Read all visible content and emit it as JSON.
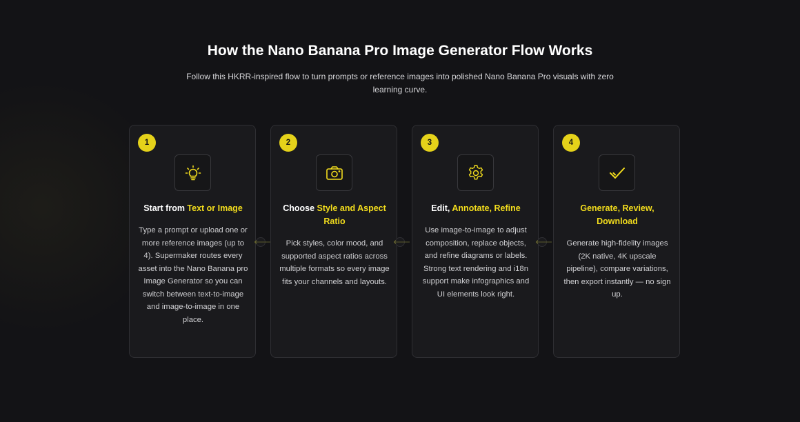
{
  "header": {
    "title": "How the Nano Banana Pro Image Generator Flow Works",
    "subtitle_line1": "Follow this HKRR-inspired flow to turn prompts or reference images into polished Nano Banana Pro visuals with zero",
    "subtitle_line2": "learning curve."
  },
  "colors": {
    "accent": "#f3dd1d",
    "badge": "#e5d21a",
    "background": "#131316",
    "card": "#1a1a1d"
  },
  "steps": [
    {
      "number": "1",
      "icon": "lightbulb-icon",
      "heading_plain": "Start from ",
      "heading_highlight": "Text or Image",
      "body": "Type a prompt or upload one or more reference images (up to 4). Supermaker routes every asset into the Nano Banana pro Image Generator so you can switch between text-to-image and image-to-image in one place."
    },
    {
      "number": "2",
      "icon": "camera-icon",
      "heading_plain": "Choose ",
      "heading_highlight": "Style and Aspect Ratio",
      "body": "Pick styles, color mood, and supported aspect ratios across multiple formats so every image fits your channels and layouts."
    },
    {
      "number": "3",
      "icon": "gear-icon",
      "heading_plain": "Edit, ",
      "heading_highlight": "Annotate, Refine",
      "body": "Use image-to-image to adjust composition, replace objects, and refine diagrams or labels. Strong text rendering and i18n support make infographics and UI elements look right."
    },
    {
      "number": "4",
      "icon": "checkmark-icon",
      "heading_plain": "",
      "heading_highlight": "Generate, Review, Download",
      "body": "Generate high-fidelity images (2K native, 4K upscale pipeline), compare variations, then export instantly — no sign up."
    }
  ]
}
